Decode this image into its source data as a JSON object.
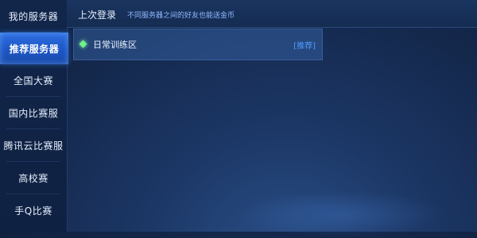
{
  "sidebar": {
    "items": [
      {
        "label": "我的服务器",
        "active": false
      },
      {
        "label": "推荐服务器",
        "active": true
      },
      {
        "label": "全国大赛",
        "active": false
      },
      {
        "label": "国内比赛服",
        "active": false
      },
      {
        "label": "腾讯云比赛服",
        "active": false
      },
      {
        "label": "高校赛",
        "active": false
      },
      {
        "label": "手Q比赛",
        "active": false
      }
    ]
  },
  "header": {
    "title": "上次登录",
    "hint": "不同服务器之间的好友也能送金币"
  },
  "servers": [
    {
      "name": "日常训练区",
      "tag": "[推荐]",
      "status_icon": "green-diamond-icon",
      "status_color": "#6ff08a"
    }
  ],
  "colors": {
    "accent": "#2f6fe0",
    "tag": "#4f9bff",
    "hint": "#8fb8ff"
  }
}
